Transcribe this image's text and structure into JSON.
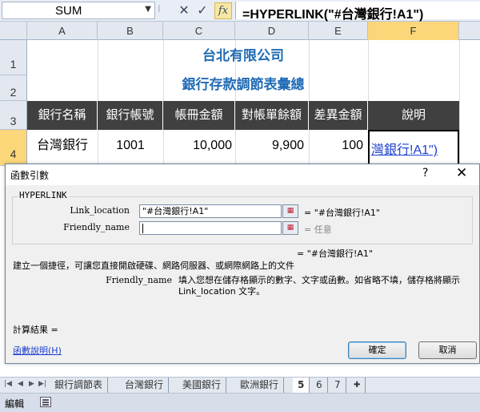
{
  "formula_bar": {
    "name_box": "SUM",
    "name_box_dropdown_icon": "chevron-down-icon",
    "cancel_icon": "close-icon",
    "enter_icon": "check-icon",
    "fx_label": "fx",
    "formula": "=HYPERLINK(\"#台灣銀行!A1\")"
  },
  "grid": {
    "columns": [
      "A",
      "B",
      "C",
      "D",
      "E",
      "F"
    ],
    "active_column": "F",
    "rows": [
      "1",
      "2",
      "3",
      "4"
    ],
    "active_row": "4",
    "title1": "台北有限公司",
    "title2": "銀行存款調節表彙總",
    "headers": [
      "銀行名稱",
      "銀行帳號",
      "帳冊金額",
      "對帳單餘額",
      "差異金額",
      "說明"
    ],
    "row4": {
      "bank": "台灣銀行",
      "account": "1001",
      "book_amount": "10,000",
      "statement_balance": "9,900",
      "difference": "100",
      "note": "灣銀行!A1\")"
    },
    "accent_color": "#1f6bb5",
    "header_fill": "#404040"
  },
  "dialog": {
    "title": "函數引數",
    "help_icon": "?",
    "close_icon": "✕",
    "function_name": "HYPERLINK",
    "args": [
      {
        "label": "Link_location",
        "value": "\"#台灣銀行!A1\"",
        "result": "=  \"#台灣銀行!A1\""
      },
      {
        "label": "Friendly_name",
        "value": "",
        "result": "=  任意"
      }
    ],
    "overall_result": "=  \"#台灣銀行!A1\"",
    "description": "建立一個捷徑，可讓您直接開啟硬碟、網路伺服器、或網際網路上的文件",
    "arg_desc_name": "Friendly_name",
    "arg_desc_text": "填入您想在儲存格顯示的數字、文字或函數。如省略不填，儲存格將顯示 Link_location 文字。",
    "calc_result": "計算結果 =",
    "help_link": "函數說明(H)",
    "ok": "確定",
    "cancel": "取消"
  },
  "sheet_tabs": {
    "tabs": [
      "銀行調節表",
      "台灣銀行",
      "美國銀行",
      "歐洲銀行",
      "5",
      "6",
      "7"
    ],
    "active_index": 4
  },
  "status_bar": {
    "mode": "編輯"
  }
}
